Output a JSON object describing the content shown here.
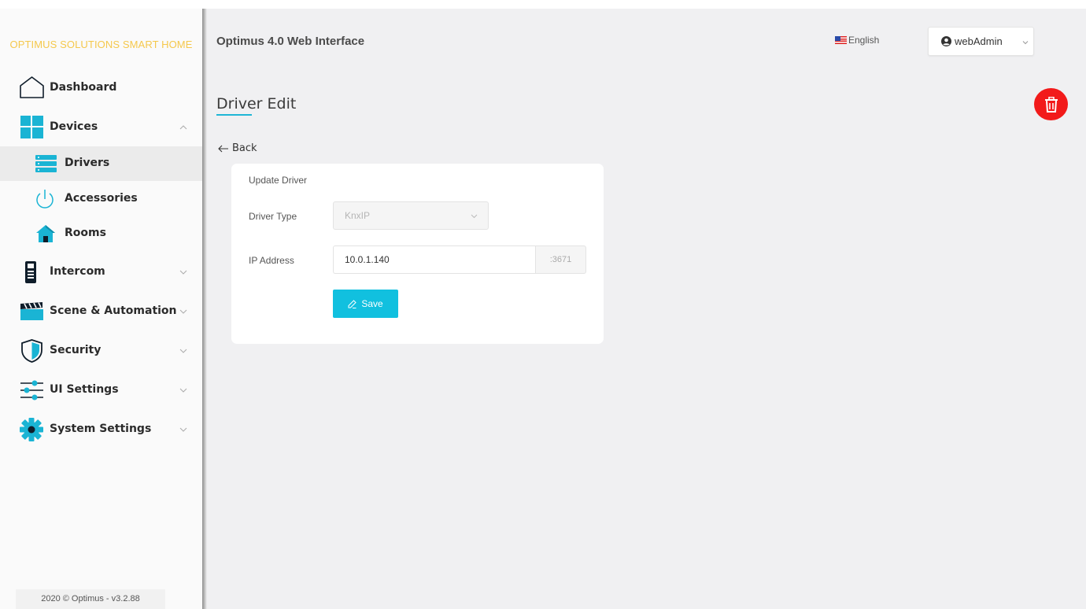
{
  "brand": "OPTIMUS SOLUTIONS SMART HOME",
  "header": {
    "title": "Optimus 4.0 Web Interface",
    "language": "English",
    "user": "webAdmin"
  },
  "sidebar": {
    "items": [
      {
        "label": "Dashboard",
        "icon": "home-outline-icon"
      },
      {
        "label": "Devices",
        "icon": "grid-icon",
        "expanded": true
      },
      {
        "label": "Drivers",
        "icon": "server-icon",
        "active": true
      },
      {
        "label": "Accessories",
        "icon": "power-icon"
      },
      {
        "label": "Rooms",
        "icon": "house-icon"
      },
      {
        "label": "Intercom",
        "icon": "intercom-icon"
      },
      {
        "label": "Scene & Automation",
        "icon": "clapperboard-icon"
      },
      {
        "label": "Security",
        "icon": "shield-icon"
      },
      {
        "label": "UI Settings",
        "icon": "sliders-icon"
      },
      {
        "label": "System Settings",
        "icon": "gear-icon"
      }
    ],
    "footer": "2020 © Optimus - v3.2.88"
  },
  "page": {
    "title": "Driver Edit",
    "back_label": "Back",
    "card": {
      "title": "Update Driver",
      "driver_type_label": "Driver Type",
      "driver_type_value": "KnxIP",
      "ip_label": "IP Address",
      "ip_value": "10.0.1.140",
      "port_addon": ":3671",
      "save_label": "Save"
    }
  },
  "colors": {
    "accent": "#1fb6d6",
    "brand_text": "#f5c84c",
    "delete": "#f21a1a",
    "save": "#11c0df"
  }
}
